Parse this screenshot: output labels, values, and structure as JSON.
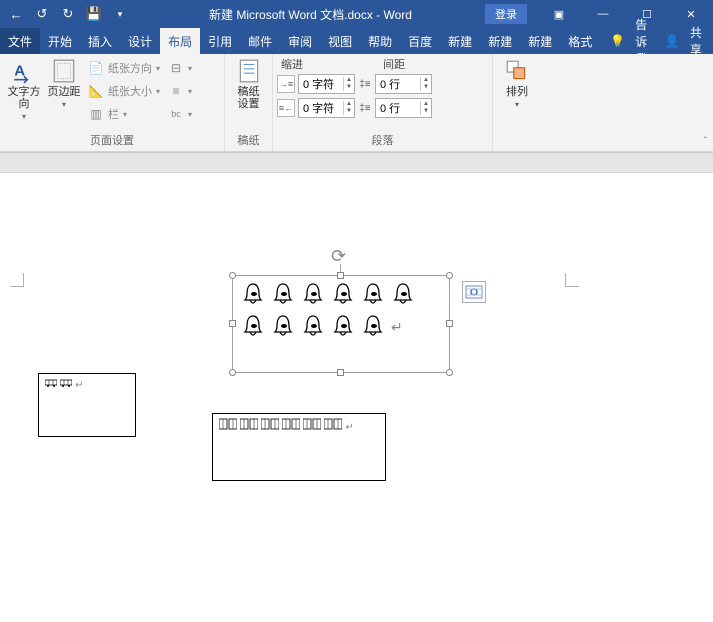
{
  "titlebar": {
    "doc_title": "新建 Microsoft Word 文档.docx - Word",
    "login": "登录"
  },
  "tabs": {
    "file": "文件",
    "home": "开始",
    "insert": "插入",
    "design": "设计",
    "layout": "布局",
    "references": "引用",
    "mailings": "邮件",
    "review": "审阅",
    "view": "视图",
    "help": "帮助",
    "baidu": "百度",
    "new1": "新建",
    "new2": "新建",
    "new3": "新建",
    "format": "格式",
    "tellme": "告诉我",
    "share": "共享"
  },
  "ribbon": {
    "text_direction": "文字方向",
    "margins": "页边距",
    "orientation": "纸张方向",
    "size": "纸张大小",
    "columns": "栏",
    "breaks": "分隔符",
    "line_numbers": "行号",
    "hyphenation": "断字",
    "page_setup_label": "页面设置",
    "manuscript": "稿纸\n设置",
    "manuscript_label": "稿纸",
    "indent_header": "缩进",
    "spacing_header": "间距",
    "indent_left_val": "0 字符",
    "indent_right_val": "0 字符",
    "space_before_val": "0 行",
    "space_after_val": "0 行",
    "paragraph_label": "段落",
    "arrange": "排列"
  }
}
